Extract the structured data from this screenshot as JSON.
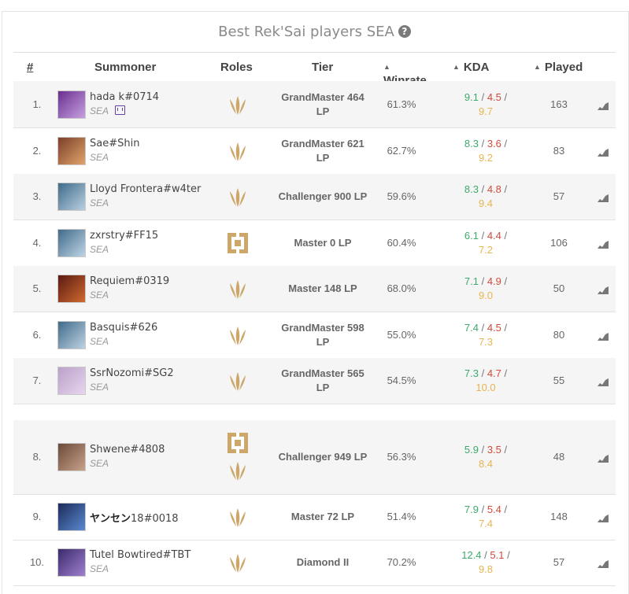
{
  "title": "Best Rek'Sai players SEA",
  "headers": {
    "rank": "#",
    "summoner": "Summoner",
    "roles": "Roles",
    "tier": "Tier",
    "winrate": "Winrate",
    "kda": "KDA",
    "played": "Played"
  },
  "colors": {
    "kill": "#3caa6b",
    "death": "#d04a3a",
    "assist": "#e8b552",
    "role_gold": "#cda769"
  },
  "rows": [
    {
      "rank": "1.",
      "name": "hada k",
      "tag": "#0714",
      "region": "SEA",
      "tier_line1": "GrandMaster 464",
      "tier_line2": "LP",
      "winrate": "61.3%",
      "k": "9.1",
      "d": "4.5",
      "a": "9.7",
      "played": "163",
      "roles": [
        "jungle-icon"
      ],
      "twitch": true
    },
    {
      "rank": "2.",
      "name": "Sae",
      "tag": "#Shin",
      "region": "SEA",
      "tier_line1": "GrandMaster 621",
      "tier_line2": "LP",
      "winrate": "62.7%",
      "k": "8.3",
      "d": "3.6",
      "a": "9.2",
      "played": "83",
      "roles": [
        "jungle-icon"
      ]
    },
    {
      "rank": "3.",
      "name": "Lloyd Frontera",
      "tag": "#w4ter",
      "region": "SEA",
      "tier_line1": "Challenger 900 LP",
      "tier_line2": "",
      "winrate": "59.6%",
      "k": "8.3",
      "d": "4.8",
      "a": "9.4",
      "played": "57",
      "roles": [
        "jungle-icon"
      ]
    },
    {
      "rank": "4.",
      "name": "zxrstry",
      "tag": "#FF15",
      "region": "SEA",
      "tier_line1": "Master 0 LP",
      "tier_line2": "",
      "winrate": "60.4%",
      "k": "6.1",
      "d": "4.4",
      "a": "7.2",
      "played": "106",
      "roles": [
        "support-icon"
      ]
    },
    {
      "rank": "5.",
      "name": "Requiem",
      "tag": "#0319",
      "region": "SEA",
      "tier_line1": "Master 148 LP",
      "tier_line2": "",
      "winrate": "68.0%",
      "k": "7.1",
      "d": "4.9",
      "a": "9.0",
      "played": "50",
      "roles": [
        "jungle-icon"
      ]
    },
    {
      "rank": "6.",
      "name": "Basquis",
      "tag": "#626",
      "region": "SEA",
      "tier_line1": "GrandMaster 598",
      "tier_line2": "LP",
      "winrate": "55.0%",
      "k": "7.4",
      "d": "4.5",
      "a": "7.3",
      "played": "80",
      "roles": [
        "jungle-icon"
      ]
    },
    {
      "rank": "7.",
      "name": "SsrNozomi",
      "tag": "#SG2",
      "region": "SEA",
      "tier_line1": "GrandMaster 565",
      "tier_line2": "LP",
      "winrate": "54.5%",
      "k": "7.3",
      "d": "4.7",
      "a": "10.0",
      "played": "55",
      "roles": [
        "jungle-icon"
      ]
    },
    {
      "rank": "8.",
      "name": "Shwene",
      "tag": "#4808",
      "region": "SEA",
      "tier_line1": "Challenger 949 LP",
      "tier_line2": "",
      "winrate": "56.3%",
      "k": "5.9",
      "d": "3.5",
      "a": "8.4",
      "played": "48",
      "roles": [
        "support-icon",
        "jungle-icon"
      ]
    },
    {
      "rank": "9.",
      "name": "ヤンセン",
      "name_suffix": "18",
      "tag": "#0018",
      "region": "",
      "tier_line1": "Master 72 LP",
      "tier_line2": "",
      "winrate": "51.4%",
      "k": "7.9",
      "d": "5.4",
      "a": "7.4",
      "played": "148",
      "roles": [
        "jungle-icon"
      ]
    },
    {
      "rank": "10.",
      "name": "Tutel Bowtired",
      "tag": "#TBT",
      "region": "SEA",
      "tier_line1": "Diamond II",
      "tier_line2": "",
      "winrate": "70.2%",
      "k": "12.4",
      "d": "5.1",
      "a": "9.8",
      "played": "57",
      "roles": [
        "jungle-icon"
      ]
    }
  ]
}
